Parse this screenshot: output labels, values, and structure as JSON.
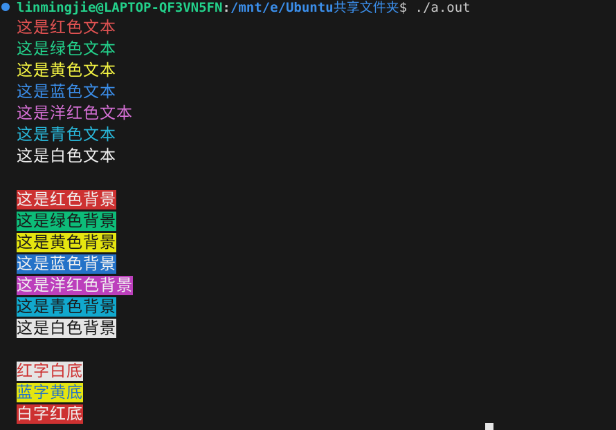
{
  "prompt": {
    "user_host": "linmingjie@LAPTOP-QF3VN5FN",
    "colon": ":",
    "path": "/mnt/e/Ubuntu",
    "path_cjk": "共享文件夹",
    "dollar": "$",
    "command": " ./a.out"
  },
  "foreground_lines": [
    "这是红色文本",
    "这是绿色文本",
    "这是黄色文本",
    "这是蓝色文本",
    "这是洋红色文本",
    "这是青色文本",
    "这是白色文本"
  ],
  "background_lines": [
    "这是红色背景",
    "这是绿色背景",
    "这是黄色背景",
    "这是蓝色背景",
    "这是洋红色背景",
    "这是青色背景",
    "这是白色背景"
  ],
  "combo_lines": [
    "红字白底",
    "蓝字黄底",
    "白字红底"
  ],
  "colors": {
    "terminal_bg": "#181818",
    "red": "#cd3131",
    "green": "#0dbc79",
    "yellow": "#e5e510",
    "blue": "#2472c8",
    "magenta": "#bc3fbc",
    "cyan": "#11a8cd",
    "white": "#e5e5e5"
  },
  "icons": {
    "status_dot": "circle-dot-icon"
  }
}
